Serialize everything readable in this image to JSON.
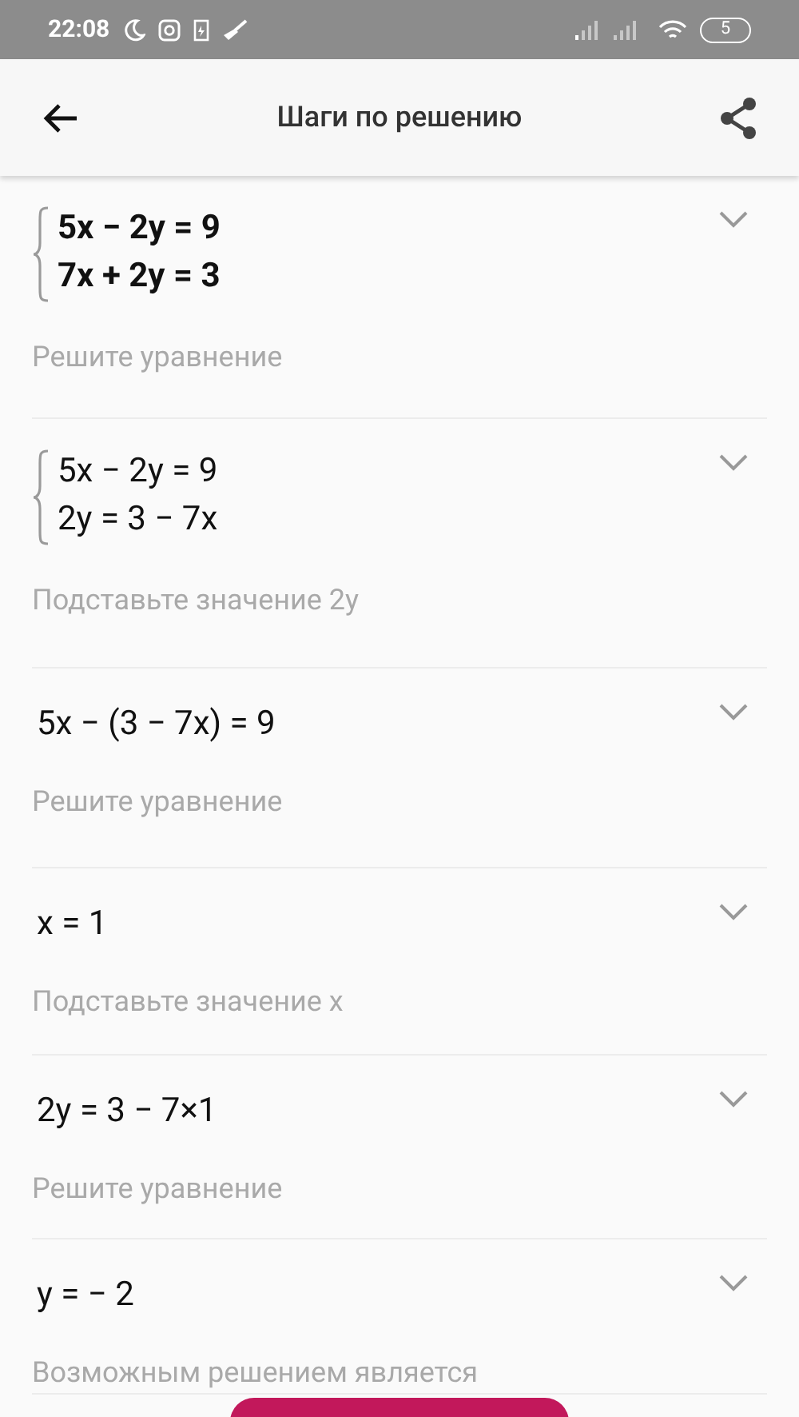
{
  "status_bar": {
    "time": "22:08",
    "battery": "5"
  },
  "app_bar": {
    "title": "Шаги по решению"
  },
  "steps": [
    {
      "kind": "system",
      "lines": [
        "5x − 2y = 9",
        "7x + 2y = 3"
      ],
      "bold": true,
      "expanded": false,
      "caption": "Решите уравнение"
    },
    {
      "kind": "system",
      "lines": [
        "5x − 2y = 9",
        "2y = 3 − 7x"
      ],
      "bold": false,
      "expanded": false,
      "caption": "Подставьте значение 2y"
    },
    {
      "kind": "line",
      "lines": [
        "5x − (3 − 7x) = 9"
      ],
      "bold": false,
      "expanded": false,
      "caption": "Решите уравнение"
    },
    {
      "kind": "line",
      "lines": [
        "x = 1"
      ],
      "bold": false,
      "expanded": false,
      "caption": "Подставьте значение x"
    },
    {
      "kind": "line",
      "lines": [
        "2y = 3 − 7×1"
      ],
      "bold": false,
      "expanded": false,
      "caption": "Решите уравнение"
    },
    {
      "kind": "line",
      "lines": [
        "y = − 2"
      ],
      "bold": false,
      "expanded": false,
      "caption": "Возможным решением является"
    }
  ]
}
